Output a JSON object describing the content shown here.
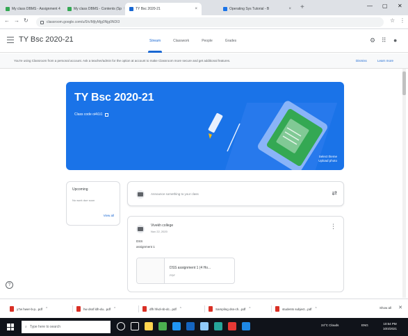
{
  "browser": {
    "tabs": [
      {
        "label": "My class DBMS - Assignment 4",
        "color": "#34a853"
      },
      {
        "label": "My class DBMS - Contents (Sp",
        "color": "#34a853"
      },
      {
        "label": "TY Bsc 2020-21",
        "color": "#1967d2",
        "active": true
      },
      {
        "label": "Operating Sys Tutorial - B",
        "color": "#1a73e8"
      }
    ],
    "url": "classroom.google.com/u/0/c/MjIyMjg0Njg0NDI3"
  },
  "app": {
    "title": "TY Bsc 2020-21",
    "nav": [
      "Stream",
      "Classwork",
      "People",
      "Grades"
    ]
  },
  "banner": {
    "text": "You're using Classroom from a personal account. Ask a teacher/admin for the option at account to make Classroom more secure and get additional features.",
    "dismiss": "Dismiss",
    "learn_more": "Learn more"
  },
  "course": {
    "title": "TY Bsc 2020-21",
    "class_code": "Class code  oi4i1i1",
    "info_line1": "Select theme",
    "info_line2": "Upload photo"
  },
  "upcoming": {
    "title": "Upcoming",
    "subtitle": "No work due soon",
    "view_all": "View all"
  },
  "share": {
    "placeholder": "Announce something to your class"
  },
  "post": {
    "author": "Vivekh college",
    "date": "Nov 22, 2020",
    "line1": "DSS",
    "line2": "assignment 1",
    "attachment_name": "DSS assignment 1 (4 Ho...",
    "attachment_type": "PDF"
  },
  "downloads": [
    {
      "label": "y7w hwer-b-p...pdf"
    },
    {
      "label": "hw dssf ldh-du...pdf"
    },
    {
      "label": "dfh hfvd-nb-dc...pdf"
    },
    {
      "label": "Sampling dss-ch...pdf"
    },
    {
      "label": "students subject...pdf"
    }
  ],
  "shelf": {
    "show_all": "Show all"
  },
  "taskbar": {
    "search_placeholder": "Type here to search",
    "weather": "24°C Clouds",
    "lang": "ENG",
    "time": "10:54 PM",
    "date": "10/4/2021",
    "icon_colors": [
      "#f5f5f5",
      "#f5f5f5",
      "#ffd54f",
      "#4caf50",
      "#2196f3",
      "#1565c0",
      "#90caf9",
      "#26a69a",
      "#e53935",
      "#1e88e5"
    ]
  }
}
